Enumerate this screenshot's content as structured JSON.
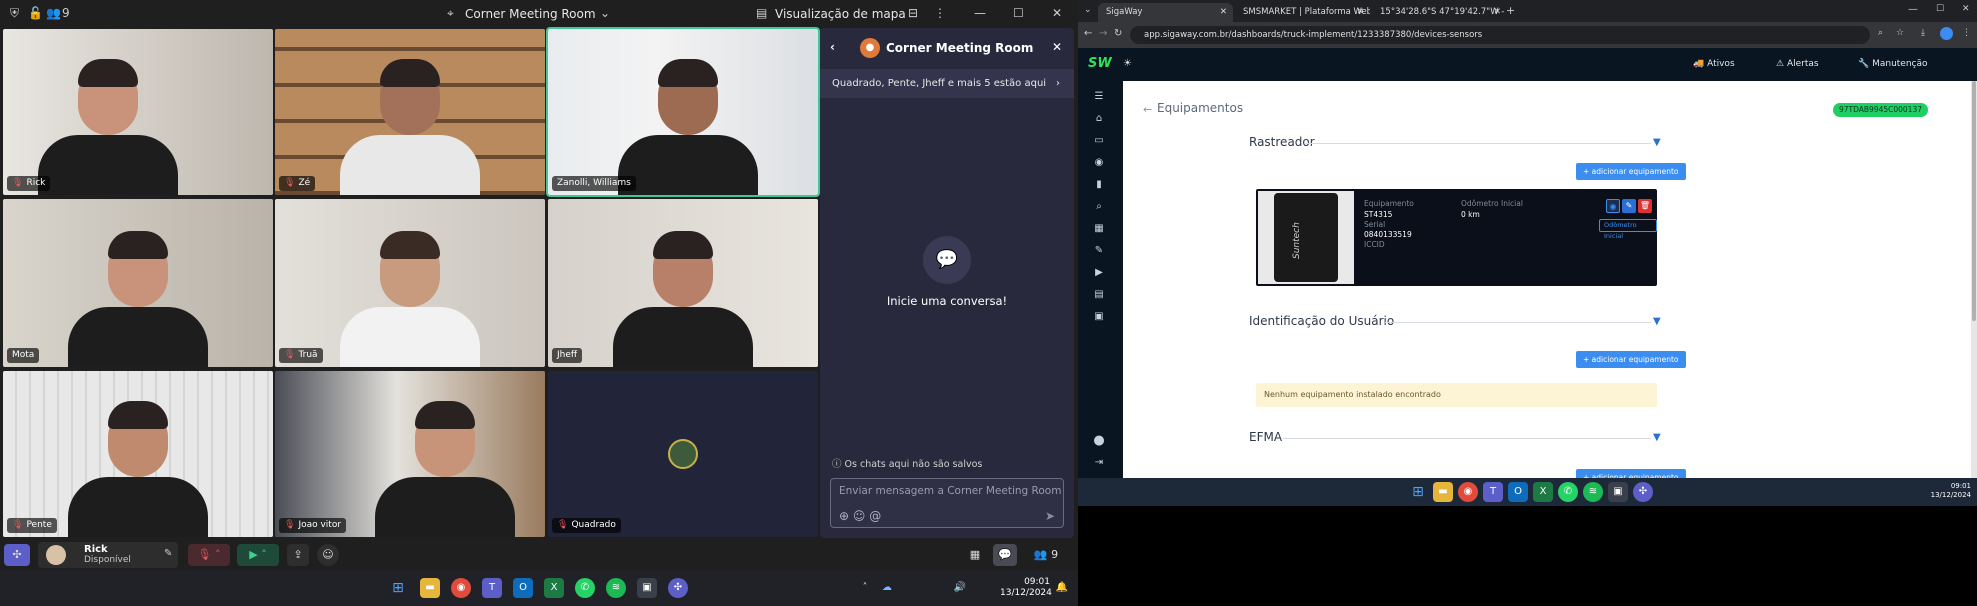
{
  "teams": {
    "top": {
      "participants_count": "9",
      "meeting_title": "Corner Meeting Room",
      "map_view": "Visualização de mapa"
    },
    "tiles": [
      {
        "name": "Rick",
        "muted": true
      },
      {
        "name": "Zé",
        "muted": true
      },
      {
        "name": "Zanolli, Williams",
        "muted": false
      },
      {
        "name": "Mota",
        "muted": false
      },
      {
        "name": "Truã",
        "muted": true
      },
      {
        "name": "Jheff",
        "muted": false
      },
      {
        "name": "Pente",
        "muted": true
      },
      {
        "name": "Joao vitor",
        "muted": true
      },
      {
        "name": "Quadrado",
        "muted": true
      }
    ],
    "chat": {
      "title": "Corner Meeting Room",
      "banner": "Quadrado, Pente, Jheff e mais 5 estão aqui",
      "empty_text": "Inicie uma conversa!",
      "note": "Os chats aqui não são salvos",
      "input_placeholder": "Enviar mensagem a Corner Meeting Room"
    },
    "bottom": {
      "user_name": "Rick",
      "user_status": "Disponível",
      "people_count": "9"
    },
    "taskbar_time": "09:01",
    "taskbar_date": "13/12/2024"
  },
  "browser": {
    "tabs": [
      {
        "label": "SigaWay"
      },
      {
        "label": "SMSMARKET | Plataforma Web..."
      },
      {
        "label": "15°34'28.6\"S 47°19'42.7\"W - G..."
      }
    ],
    "url": "app.sigaway.com.br/dashboards/truck-implement/1233387380/devices-sensors"
  },
  "sigaway": {
    "logo": "SW",
    "nav": [
      {
        "label": "Ativos"
      },
      {
        "label": "Alertas"
      },
      {
        "label": "Manutenção"
      }
    ],
    "page_title": "Equipamentos",
    "id_badge": "97TDAB9945C000137",
    "sections": {
      "rastreador": "Rastreador",
      "identificacao": "Identificação do Usuário",
      "efma": "EFMA"
    },
    "add_button": "+ adicionar equipamento",
    "device": {
      "brand": "Suntech",
      "equip_label": "Equipamento",
      "equip_value": "ST4315",
      "serial_label": "Serial",
      "serial_value": "0840133519",
      "iccid_label": "ICCID",
      "odometer_label": "Odômetro Inicial",
      "odometer_value": "0 km",
      "odometer_button": "Odômetro Inicial"
    },
    "empty_message": "Nenhum equipamento instalado encontrado"
  },
  "right_taskbar_time": "09:01",
  "right_taskbar_date": "13/12/2024",
  "colors": {
    "teams_bg": "#1f1f1f",
    "chat_bg": "#29293d",
    "sigaway_green": "#2ee35a",
    "button_blue": "#3b8df0"
  }
}
